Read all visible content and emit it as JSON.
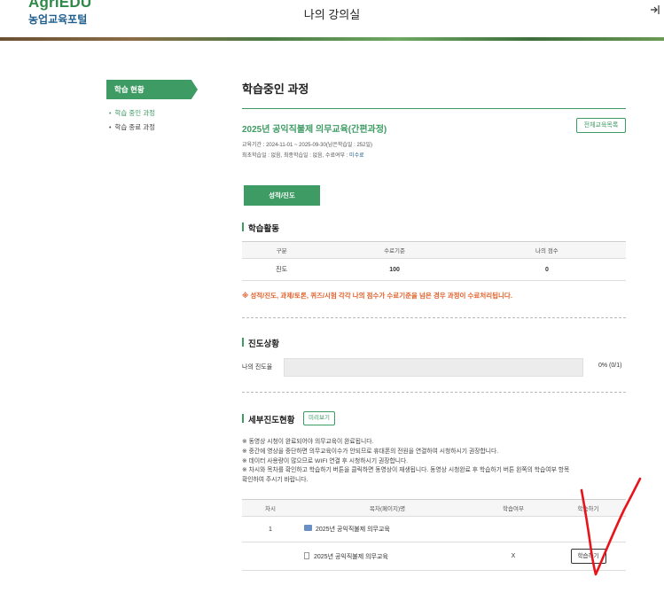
{
  "header": {
    "logo_en": "AgriEDU",
    "logo_ko": "농업교육포털",
    "title": "나의 강의실",
    "logout_icon": "logout-icon"
  },
  "sidebar": {
    "title": "학습 현황",
    "items": [
      {
        "label": "학습 중인 과정",
        "active": true
      },
      {
        "label": "학습 종료 과정",
        "active": false
      }
    ]
  },
  "main": {
    "title": "학습중인 과정",
    "course": {
      "title": "2025년 공익직불제 의무교육(간편과정)",
      "all_courses_button": "전체교육목록",
      "period": "교육기간 : 2024-11-01 ~ 2025-09-30(남은학습일 : 252일)",
      "status_prefix": "최초학습일 : 없음, 최종학습일 : 없음, 수료여부 : ",
      "status_value": "미수료"
    },
    "grade_button": "성적/진도",
    "activity": {
      "title": "학습활동",
      "headers": [
        "구분",
        "수료기준",
        "나의 점수"
      ],
      "rows": [
        [
          "진도",
          "100",
          "0"
        ]
      ]
    },
    "notice": "※ 성적/진도, 과제/토론, 퀴즈/시험 각각 나의 점수가 수료기준을 넘은 경우 과정이 수료처리됩니다.",
    "progress": {
      "title": "진도상황",
      "label": "나의 진도율",
      "value": 0,
      "value_text": "0% (0/1)"
    },
    "detail": {
      "title": "세부진도현황",
      "preview_button": "미리보기",
      "instructions": [
        "※ 동영상 시청이 완료되어야 의무교육이 완료됩니다.",
        "※ 중간에 영상을 중단하면 의무교육이수가 안되므로 휴대폰의 전원을 연결하여 시청하시기 권장합니다.",
        "※ 데이터 사용량이 많으므로 WIFI 연결 후 시청하시기 권장합니다.",
        "※ 차시와 목차를 확인하고 학습하기 버튼을 클릭하면 동영상이 재생됩니다. 동영상 시청완료 후 학습하기 버튼 왼쪽의 학습여부 항목",
        "확인하여 주시기 바랍니다."
      ],
      "headers": [
        "차시",
        "목차(페이지)명",
        "학습여부",
        "학습하기"
      ],
      "rows": [
        {
          "session": "1",
          "title": "2025년 공익직불제 의무교육",
          "done": "",
          "button": ""
        },
        {
          "session": "",
          "title": "2025년 공익직불제 의무교육",
          "done": "X",
          "button": "학습하기"
        }
      ]
    }
  },
  "colors": {
    "accent": "#3d9b63",
    "notice": "#e0602a",
    "annotation": "#e8141b"
  }
}
